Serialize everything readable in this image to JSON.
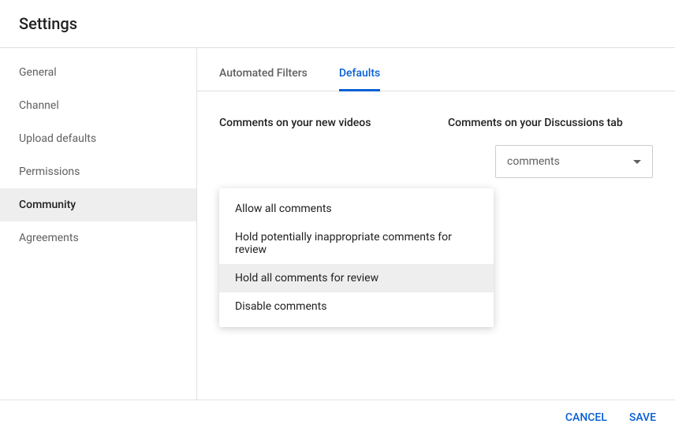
{
  "header": {
    "title": "Settings"
  },
  "sidebar": {
    "items": [
      {
        "label": "General",
        "active": false
      },
      {
        "label": "Channel",
        "active": false
      },
      {
        "label": "Upload defaults",
        "active": false
      },
      {
        "label": "Permissions",
        "active": false
      },
      {
        "label": "Community",
        "active": true
      },
      {
        "label": "Agreements",
        "active": false
      }
    ]
  },
  "tabs": [
    {
      "label": "Automated Filters",
      "active": false
    },
    {
      "label": "Defaults",
      "active": true
    }
  ],
  "sections": {
    "left": {
      "title": "Comments on your new videos"
    },
    "right": {
      "title": "Comments on your Discussions tab",
      "selected": "comments"
    }
  },
  "dropdown": {
    "options": [
      {
        "label": "Allow all comments",
        "highlighted": false
      },
      {
        "label": "Hold potentially inappropriate comments for review",
        "highlighted": false
      },
      {
        "label": "Hold all comments for review",
        "highlighted": true
      },
      {
        "label": "Disable comments",
        "highlighted": false
      }
    ]
  },
  "footer": {
    "cancel": "CANCEL",
    "save": "SAVE"
  }
}
